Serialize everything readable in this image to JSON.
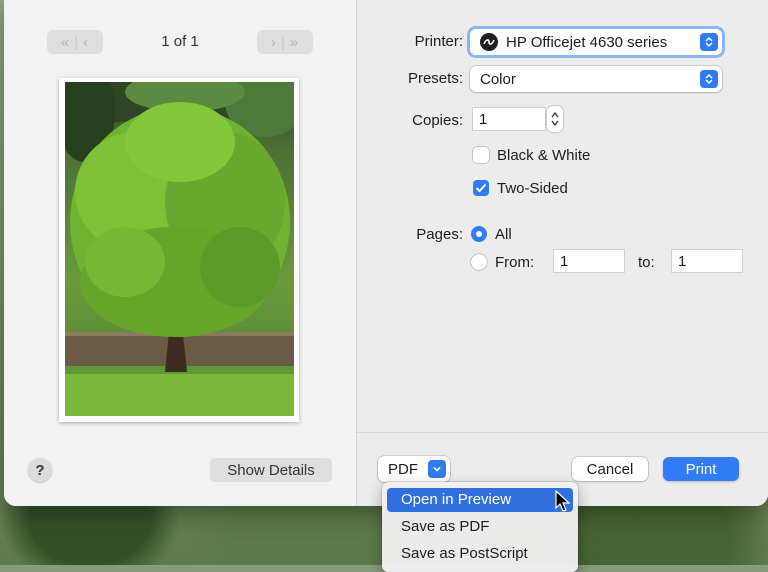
{
  "preview": {
    "page_count": "1 of 1",
    "show_details_label": "Show Details",
    "help_label": "?"
  },
  "printer": {
    "label": "Printer:",
    "value": "HP Officejet 4630 series"
  },
  "presets": {
    "label": "Presets:",
    "value": "Color"
  },
  "copies": {
    "label": "Copies:",
    "value": "1"
  },
  "options": {
    "black_white_label": "Black & White",
    "black_white_checked": false,
    "two_sided_label": "Two-Sided",
    "two_sided_checked": true
  },
  "pages": {
    "label": "Pages:",
    "all_label": "All",
    "from_label": "From:",
    "to_label": "to:",
    "from_value": "1",
    "to_value": "1",
    "selected": "All"
  },
  "footer": {
    "pdf_label": "PDF",
    "cancel_label": "Cancel",
    "print_label": "Print"
  },
  "pdf_menu": {
    "items": [
      "Open in Preview",
      "Save as PDF",
      "Save as PostScript"
    ],
    "highlighted": "Open in Preview"
  },
  "colors": {
    "accent": "#2f7cf6",
    "menu_highlight": "#2f6fde"
  }
}
